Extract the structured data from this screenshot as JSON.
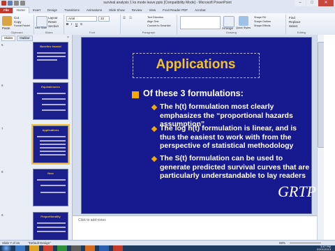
{
  "window": {
    "title": "survival analysis 1 ks mode leave.pptx [Compatibility Mode] - Microsoft PowerPoint",
    "minimize": "–",
    "maximize": "□",
    "close": "✕"
  },
  "ribbon_tabs": [
    "File",
    "Home",
    "Insert",
    "Design",
    "Transitions",
    "Animations",
    "Slide Show",
    "Review",
    "View",
    "Foxit Reader PDF",
    "Acrobat"
  ],
  "ribbon": {
    "paste": "Paste",
    "cut": "Cut",
    "copy": "Copy",
    "format_painter": "Format Painter",
    "new_slide": "New Slide",
    "layout": "Layout",
    "reset": "Reset",
    "section": "Section",
    "groups": [
      "Clipboard",
      "Slides",
      "Font",
      "Paragraph",
      "Drawing",
      "Editing"
    ],
    "font_name": "Arial",
    "font_size": "32",
    "find": "Find",
    "replace": "Replace",
    "select": "Select",
    "shape_fill": "Shape Fill",
    "shape_outline": "Shape Outline",
    "shape_effects": "Shape Effects",
    "arrange": "Arrange",
    "quick_styles": "Quick Styles",
    "text_direction": "Text Direction",
    "align_text": "Align Text",
    "convert_smartart": "Convert to SmartArt"
  },
  "pane": {
    "tabs": [
      "Slides",
      "Outline"
    ],
    "close": "×",
    "thumbnails": [
      {
        "number": "5",
        "title": "Baseline hazard"
      },
      {
        "number": "6",
        "title": "Equivalencies"
      },
      {
        "number": "7",
        "title": "Applications",
        "selected": true
      },
      {
        "number": "8",
        "title": "Now"
      },
      {
        "number": "9",
        "title": "Proportionality"
      }
    ]
  },
  "slide": {
    "title": "Applications",
    "bullet": "Of these 3 formulations:",
    "sub_bullets": [
      "The h(t) formulation most clearly emphasizes the “proportional hazards assumption”",
      "The log h(t) formulation is linear, and is thus the easiest to work with from the perspective of statistical methodology",
      "The S(t) formulation can be used to generate predicted survival curves that are particularly understandable to lay readers"
    ],
    "logo": "GRTP"
  },
  "notes": {
    "placeholder": "Click to add notes"
  },
  "status": {
    "slide_info": "Slide 7 of 16",
    "theme": "\"Default Design\"",
    "zoom": "59%"
  },
  "taskbar": {
    "time": "3:47 PM",
    "date": "02/01/2013"
  },
  "colors": {
    "slide_bg": "#161a8e",
    "title": "#f2c12e",
    "bullet": "#f2a900",
    "file_tab": "#c0392b"
  }
}
